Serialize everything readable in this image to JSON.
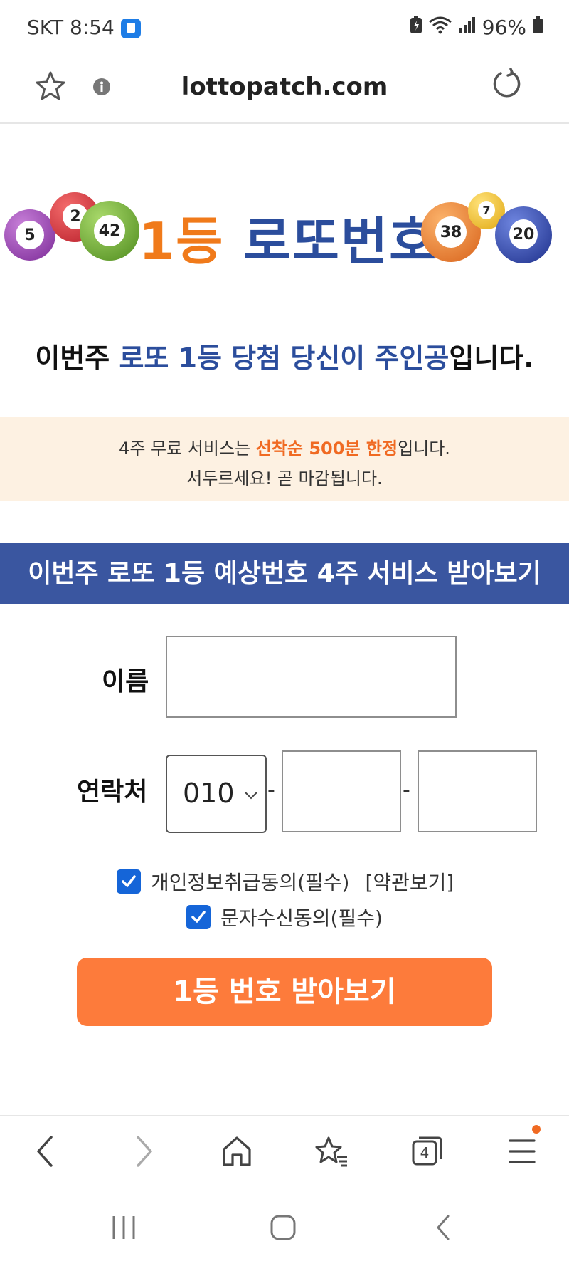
{
  "status": {
    "time": "SKT 8:54",
    "battery": "96%",
    "icons": [
      "app-notification-icon",
      "battery-saver-icon",
      "wifi-icon",
      "signal-icon",
      "battery-icon"
    ]
  },
  "url_bar": {
    "url": "lottopatch.com",
    "icons": [
      "star-icon",
      "info-icon",
      "reload-icon"
    ]
  },
  "banner": {
    "title_part1": "1등",
    "title_part2": "로또번호",
    "left_balls": [
      "5",
      "2",
      "42"
    ],
    "right_balls": [
      "38",
      "7",
      "20"
    ]
  },
  "headline": {
    "part1": "이번주 ",
    "part2": "로또 1등 당첨 당신이 주인공",
    "part3": "입니다."
  },
  "notice": {
    "line1_a": "4주 무료 서비스는 ",
    "line1_b": "선착순 500분 한정",
    "line1_c": "입니다.",
    "line2": "서두르세요! 곧 마감됩니다."
  },
  "service_title": "이번주 로또 1등 예상번호 4주 서비스 받아보기",
  "form": {
    "name_label": "이름",
    "name_value": "",
    "phone_label": "연락처",
    "phone_prefix": "010",
    "dash": "-",
    "phone_mid": "",
    "phone_last": ""
  },
  "agreements": {
    "privacy_label": "개인정보취급동의(필수)",
    "privacy_checked": true,
    "terms_link": "[약관보기]",
    "sms_label": "문자수신동의(필수)",
    "sms_checked": true
  },
  "submit_label": "1등 번호 받아보기",
  "browser_bar": {
    "tab_count": "4",
    "icons": [
      "back-icon",
      "forward-icon",
      "home-icon",
      "bookmarks-icon",
      "tabs-icon",
      "menu-icon"
    ]
  },
  "colors": {
    "accent_blue": "#3a56a0",
    "accent_orange": "#fd7b3b",
    "notice_bg": "#fdf1e2",
    "checkbox_blue": "#1565d8"
  }
}
